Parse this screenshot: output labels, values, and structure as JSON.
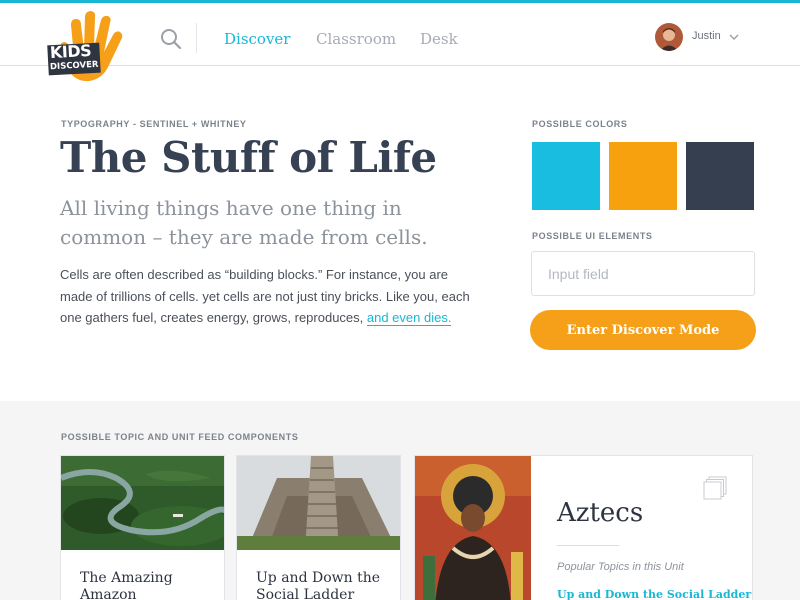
{
  "brand": {
    "logo_line1": "KIDS",
    "logo_line2": "DISCOVER"
  },
  "nav": {
    "items": [
      {
        "label": "Discover",
        "active": true
      },
      {
        "label": "Classroom",
        "active": false
      },
      {
        "label": "Desk",
        "active": false
      }
    ],
    "search_icon": "search-icon"
  },
  "user": {
    "name": "Justin",
    "menu_icon": "chevron-down-icon"
  },
  "typography_section": {
    "eyebrow": "TYPOGRAPHY - SENTINEL + WHITNEY",
    "title": "The Stuff of Life",
    "subtitle": "All living things have one thing in common – they are made from cells.",
    "body": "Cells are often described as “building blocks.” For instance, you are made of trillions of cells. yet cells are not just tiny bricks. Like you, each one gathers fuel, creates energy, grows, reproduces, ",
    "body_link": "and even dies."
  },
  "colors_section": {
    "eyebrow": "POSSIBLE COLORS",
    "swatches": [
      "#19bde0",
      "#f8a10f",
      "#363f4f"
    ]
  },
  "ui_section": {
    "eyebrow": "POSSIBLE UI ELEMENTS",
    "input_placeholder": "Input field",
    "button_label": "Enter Discover Mode"
  },
  "feed": {
    "eyebrow": "POSSIBLE TOPIC AND UNIT FEED COMPONENTS",
    "cards": [
      {
        "title": "The Amazing Amazon"
      },
      {
        "title": "Up and Down the Social Ladder"
      }
    ],
    "unit": {
      "title": "Aztecs",
      "subtitle": "Popular Topics in this Unit",
      "link": "Up and Down the Social Ladder"
    }
  },
  "colors": {
    "accent": "#19b7d6",
    "orange": "#f6a01a",
    "navy": "#364153"
  }
}
